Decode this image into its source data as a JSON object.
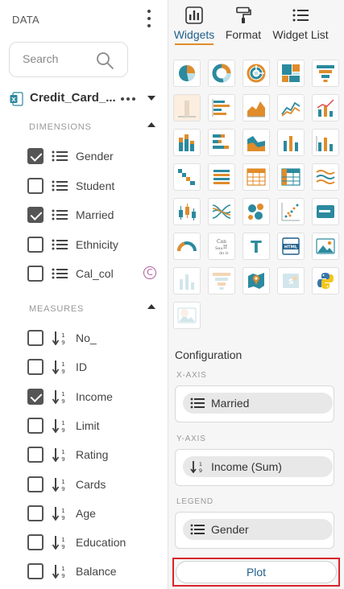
{
  "left_panel": {
    "title": "DATA",
    "search_placeholder": "Search",
    "dataset": {
      "name": "Credit_Card_..."
    },
    "dimensions": {
      "title": "DIMENSIONS",
      "items": [
        {
          "label": "Gender",
          "checked": true
        },
        {
          "label": "Student",
          "checked": false
        },
        {
          "label": "Married",
          "checked": true
        },
        {
          "label": "Ethnicity",
          "checked": false
        },
        {
          "label": "Cal_col",
          "checked": false,
          "calculated_badge": "C"
        }
      ]
    },
    "measures": {
      "title": "MEASURES",
      "items": [
        {
          "label": "No_",
          "checked": false
        },
        {
          "label": "ID",
          "checked": false
        },
        {
          "label": "Income",
          "checked": true
        },
        {
          "label": "Limit",
          "checked": false
        },
        {
          "label": "Rating",
          "checked": false
        },
        {
          "label": "Cards",
          "checked": false
        },
        {
          "label": "Age",
          "checked": false
        },
        {
          "label": "Education",
          "checked": false
        },
        {
          "label": "Balance",
          "checked": false
        }
      ]
    }
  },
  "right_panel": {
    "tabs": [
      {
        "label": "Widgets",
        "icon": "widgets-icon",
        "active": true
      },
      {
        "label": "Format",
        "icon": "paint-roller-icon",
        "active": false
      },
      {
        "label": "Widget List",
        "icon": "list-icon",
        "active": false
      }
    ],
    "widgets_grid": [
      [
        "pie-chart-icon",
        "donut-chart-icon",
        "sunburst-chart-icon",
        "treemap-icon",
        "funnel-chart-icon"
      ],
      [
        "column-chart-icon",
        "bar-chart-icon",
        "area-chart-icon",
        "line-chart-icon",
        "combo-chart-icon"
      ],
      [
        "stacked-column-icon",
        "stacked-bar-icon",
        "stacked-area-icon",
        "column-line-icon",
        "stacked-column-line-icon"
      ],
      [
        "waterfall-icon",
        "horizontal-bar-icon",
        "table-icon",
        "pivot-table-icon",
        "streamgraph-icon"
      ],
      [
        "box-plot-icon",
        "parallel-coordinates-icon",
        "bubble-chart-icon",
        "scatter-plot-icon",
        "kpi-card-icon"
      ],
      [
        "gauge-icon",
        "word-cloud-icon",
        "text-widget-icon",
        "html-widget-icon",
        "image-widget-icon"
      ],
      [
        "dimmed-column-icon",
        "dimmed-funnel-icon",
        "geo-map-icon",
        "dimmed-map-icon",
        "python-icon"
      ],
      [
        "dimmed-image-icon"
      ]
    ],
    "selected_widget": "column-chart-icon",
    "configuration": {
      "title": "Configuration",
      "x_axis": {
        "label": "X-AXIS",
        "field": "Married"
      },
      "y_axis": {
        "label": "Y-AXIS",
        "field": "Income (Sum)"
      },
      "legend": {
        "label": "LEGEND",
        "field": "Gender"
      }
    },
    "plot_button": "Plot",
    "colors": {
      "accent_orange": "#e08c2b",
      "link_blue": "#1f5f8b",
      "highlight_red": "#d8232a",
      "teal": "#2b8a9e"
    }
  }
}
